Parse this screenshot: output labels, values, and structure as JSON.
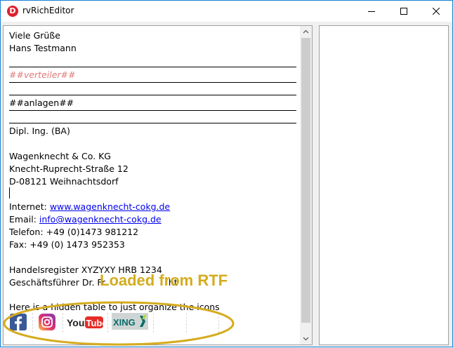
{
  "window": {
    "title": "rvRichEditor",
    "app_icon_letter": "D"
  },
  "editor": {
    "lines": {
      "greeting": "Viele Grüße",
      "name": "Hans Testmann",
      "verteiler": "##verteiler##",
      "anlagen": "##anlagen##",
      "degree": "Dipl. Ing. (BA)",
      "company": "Wagenknecht & Co. KG",
      "street": "Knecht-Ruprecht-Straße 12",
      "city": "D-08121 Weihnachtsdorf",
      "internet_label": "Internet: ",
      "internet_link": "www.wagenknecht-cokg.de",
      "email_label": "Email: ",
      "email_link": "info@wagenknecht-cokg.de",
      "phone": "Telefon: +49 (0)1473 981212",
      "fax": "Fax: +49 (0) 1473 952353",
      "register": "Handelsregister XYZYXY HRB 1234",
      "ceo": "Geschäftsführer Dr. Fr",
      "ceo_tail": "ht",
      "hidden_table": "Here is a hidden table to just organize the icons"
    },
    "icons": [
      "facebook-logo",
      "instagram-logo",
      "youtube-logo",
      "xing-logo"
    ],
    "logo_text": {
      "youtube_a": "You",
      "youtube_b": "Tube",
      "xing": "XING"
    },
    "overlay_text": "Loaded from RTF",
    "colors": {
      "field": "#e07a7a",
      "link": "#0000ee",
      "overlay": "#d4ac1e"
    }
  }
}
